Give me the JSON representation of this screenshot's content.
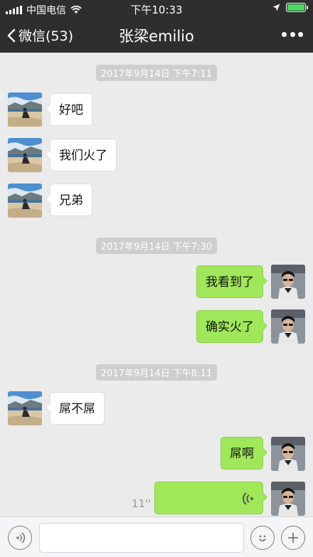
{
  "status": {
    "carrier": "中国电信",
    "time": "下午10:33"
  },
  "nav": {
    "back_label": "微信(53)",
    "title": "张梁emilio"
  },
  "messages": {
    "ts1": "2017年9月14日 下午7:11",
    "m1": "好吧",
    "m2": "我们火了",
    "m3": "兄弟",
    "ts2": "2017年9月14日 下午7:30",
    "m4": "我看到了",
    "m5": "确实火了",
    "ts3": "2017年9月14日 下午8:11",
    "m6": "屌不屌",
    "m7": "屌啊",
    "voice_duration": "11''"
  },
  "input": {
    "value": ""
  },
  "colors": {
    "header_bg": "#2e2e2e",
    "chat_bg": "#ebebeb",
    "sent_bubble": "#a0e75a",
    "received_bubble": "#ffffff",
    "battery": "#4cd964"
  },
  "icons": [
    "signal-icon",
    "wifi-icon",
    "location-icon",
    "battery-icon",
    "back-chevron-icon",
    "more-icon",
    "voice-icon",
    "emoji-icon",
    "plus-icon"
  ]
}
